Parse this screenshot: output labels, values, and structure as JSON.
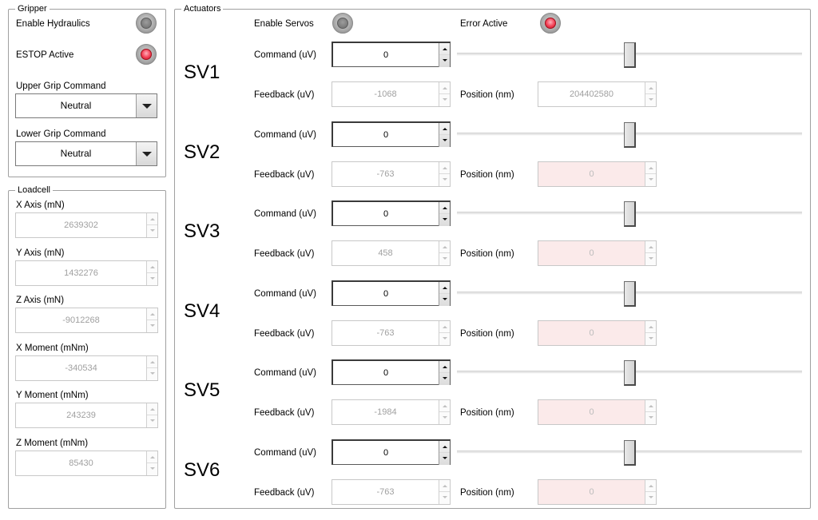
{
  "gripper": {
    "legend": "Gripper",
    "enable_hydraulics_label": "Enable Hydraulics",
    "estop_label": "ESTOP Active",
    "upper_grip_label": "Upper Grip Command",
    "upper_grip_value": "Neutral",
    "lower_grip_label": "Lower Grip Command",
    "lower_grip_value": "Neutral"
  },
  "loadcell": {
    "legend": "Loadcell",
    "fields": [
      {
        "label": "X Axis (mN)",
        "value": "2639302"
      },
      {
        "label": "Y Axis (mN)",
        "value": "1432276"
      },
      {
        "label": "Z Axis (mN)",
        "value": "-9012268"
      },
      {
        "label": "X Moment (mNm)",
        "value": "-340534"
      },
      {
        "label": "Y Moment (mNm)",
        "value": "243239"
      },
      {
        "label": "Z Moment (mNm)",
        "value": "85430"
      }
    ]
  },
  "actuators": {
    "legend": "Actuators",
    "enable_servos_label": "Enable Servos",
    "error_active_label": "Error Active",
    "command_label": "Command (uV)",
    "feedback_label": "Feedback (uV)",
    "position_label": "Position (nm)",
    "servos": [
      {
        "name": "SV1",
        "command": "0",
        "feedback": "-1068",
        "position": "204402580"
      },
      {
        "name": "SV2",
        "command": "0",
        "feedback": "-763",
        "position": "0"
      },
      {
        "name": "SV3",
        "command": "0",
        "feedback": "458",
        "position": "0"
      },
      {
        "name": "SV4",
        "command": "0",
        "feedback": "-763",
        "position": "0"
      },
      {
        "name": "SV5",
        "command": "0",
        "feedback": "-1984",
        "position": "0"
      },
      {
        "name": "SV6",
        "command": "0",
        "feedback": "-763",
        "position": "0"
      }
    ]
  },
  "indicators": {
    "enable_hydraulics": "off",
    "estop_active": "on",
    "enable_servos": "off",
    "error_active": "on"
  },
  "colors": {
    "indicator_on": "#f24055",
    "indicator_off": "#6b6b6b",
    "fault_field_bg": "#fbeaea"
  }
}
